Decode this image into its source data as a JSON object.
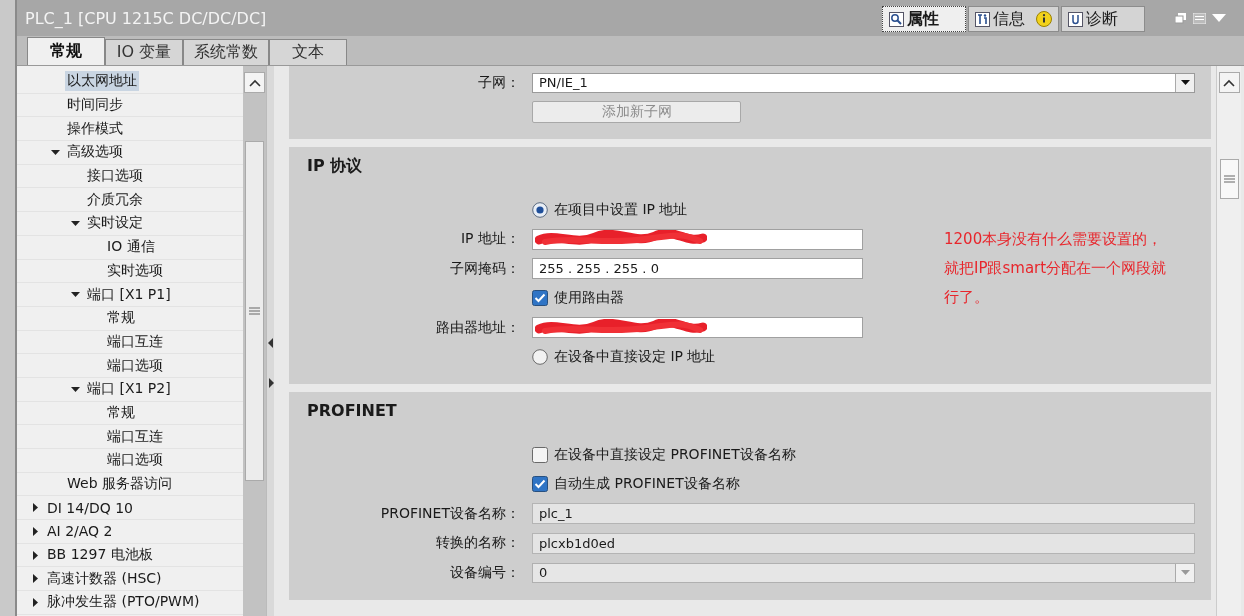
{
  "window": {
    "title": "PLC_1 [CPU 1215C DC/DC/DC]"
  },
  "inspector_tabs": [
    {
      "kind": "properties",
      "label": "属性",
      "selected": true
    },
    {
      "kind": "info",
      "label": "信息",
      "selected": false
    },
    {
      "kind": "diagnostics",
      "label": "诊断",
      "selected": false
    }
  ],
  "tabs": [
    {
      "label": "常规",
      "selected": true
    },
    {
      "label": "IO 变量",
      "selected": false
    },
    {
      "label": "系统常数",
      "selected": false
    },
    {
      "label": "文本",
      "selected": false
    }
  ],
  "tree": {
    "continued_children": [
      {
        "label": "以太网地址",
        "selected": true
      },
      {
        "label": "时间同步",
        "selected": false
      },
      {
        "label": "操作模式",
        "selected": false
      },
      {
        "label": "高级选项",
        "selected": false,
        "expanded": true,
        "children": [
          {
            "label": "接口选项",
            "selected": false
          },
          {
            "label": "介质冗余",
            "selected": false
          },
          {
            "label": "实时设定",
            "selected": false,
            "expanded": true,
            "children": [
              {
                "label": "IO 通信",
                "selected": false
              },
              {
                "label": "实时选项",
                "selected": false
              }
            ]
          },
          {
            "label": "端口 [X1 P1]",
            "selected": false,
            "expanded": true,
            "children": [
              {
                "label": "常规",
                "selected": false
              },
              {
                "label": "端口互连",
                "selected": false
              },
              {
                "label": "端口选项",
                "selected": false
              }
            ]
          },
          {
            "label": "端口 [X1 P2]",
            "selected": false,
            "expanded": true,
            "children": [
              {
                "label": "常规",
                "selected": false
              },
              {
                "label": "端口互连",
                "selected": false
              },
              {
                "label": "端口选项",
                "selected": false
              }
            ]
          }
        ]
      },
      {
        "label": "Web 服务器访问",
        "selected": false
      }
    ],
    "items": [
      {
        "label": "DI 14/DQ 10",
        "selected": false,
        "expanded": false
      },
      {
        "label": "AI 2/AQ 2",
        "selected": false,
        "expanded": false
      },
      {
        "label": "BB 1297 电池板",
        "selected": false,
        "expanded": false
      },
      {
        "label": "高速计数器 (HSC)",
        "selected": false,
        "expanded": false
      },
      {
        "label": "脉冲发生器 (PTO/PWM)",
        "selected": false,
        "expanded": false
      }
    ]
  },
  "sections": [
    {
      "rows": [
        {
          "kind": "dropdown",
          "label": "子网：",
          "value": "PN/IE_1",
          "disabled": false
        },
        {
          "kind": "button",
          "text": "添加新子网",
          "disabled": true
        }
      ]
    },
    {
      "title": "IP 协议",
      "note": "1200本身没有什么需要设置的，就把IP跟smart分配在一个网段就行了。",
      "rows": [
        {
          "kind": "radio",
          "text": "在项目中设置 IP 地址",
          "selected": true
        },
        {
          "kind": "field",
          "label": "IP 地址：",
          "redacted": true,
          "disabled": false
        },
        {
          "kind": "field",
          "label": "子网掩码：",
          "value": "255 . 255 . 255 . 0",
          "disabled": false
        },
        {
          "kind": "checkbox",
          "text": "使用路由器",
          "checked": true
        },
        {
          "kind": "field",
          "label": "路由器地址：",
          "redacted": true,
          "disabled": false
        },
        {
          "kind": "radio",
          "text": "在设备中直接设定 IP 地址",
          "selected": false
        }
      ]
    },
    {
      "title": "PROFINET",
      "rows": [
        {
          "kind": "checkbox",
          "text": "在设备中直接设定 PROFINET设备名称",
          "checked": false
        },
        {
          "kind": "checkbox",
          "text": "自动生成 PROFINET设备名称",
          "checked": true
        },
        {
          "kind": "wide_field",
          "label": "PROFINET设备名称：",
          "value": "plc_1",
          "disabled": true
        },
        {
          "kind": "wide_field",
          "label": "转换的名称：",
          "value": "plcxb1d0ed",
          "disabled": true
        },
        {
          "kind": "dropdown",
          "label": "设备编号：",
          "value": "0",
          "disabled": true
        }
      ]
    }
  ]
}
